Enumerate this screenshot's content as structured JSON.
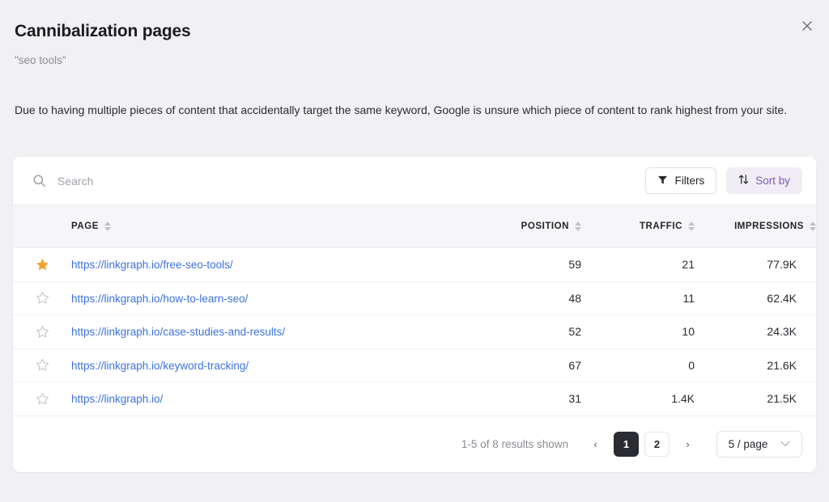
{
  "modal": {
    "title": "Cannibalization pages",
    "subtitle": "\"seo tools\"",
    "description": "Due to having multiple pieces of content that accidentally target the same keyword, Google is unsure which piece of content to rank highest from your site.",
    "close_label": "×"
  },
  "toolbar": {
    "search_placeholder": "Search",
    "search_value": "",
    "filters_label": "Filters",
    "sort_label": "Sort by"
  },
  "table": {
    "columns": [
      {
        "key": "star",
        "label": ""
      },
      {
        "key": "page",
        "label": "PAGE"
      },
      {
        "key": "position",
        "label": "POSITION"
      },
      {
        "key": "traffic",
        "label": "TRAFFIC"
      },
      {
        "key": "impressions",
        "label": "IMPRESSIONS"
      }
    ],
    "rows": [
      {
        "starred": true,
        "page": "https://linkgraph.io/free-seo-tools/",
        "position": "59",
        "traffic": "21",
        "impressions": "77.9K"
      },
      {
        "starred": false,
        "page": "https://linkgraph.io/how-to-learn-seo/",
        "position": "48",
        "traffic": "11",
        "impressions": "62.4K"
      },
      {
        "starred": false,
        "page": "https://linkgraph.io/case-studies-and-results/",
        "position": "52",
        "traffic": "10",
        "impressions": "24.3K"
      },
      {
        "starred": false,
        "page": "https://linkgraph.io/keyword-tracking/",
        "position": "67",
        "traffic": "0",
        "impressions": "21.6K"
      },
      {
        "starred": false,
        "page": "https://linkgraph.io/",
        "position": "31",
        "traffic": "1.4K",
        "impressions": "21.5K"
      }
    ]
  },
  "pagination": {
    "results_text": "1-5 of 8 results shown",
    "prev_label": "‹",
    "next_label": "›",
    "pages": [
      "1",
      "2"
    ],
    "current_page": "1",
    "per_page_label": "5 / page"
  },
  "colors": {
    "page_background": "#f1f1f4",
    "card_background": "#ffffff",
    "link": "#3b72dd",
    "star_active": "#f0a531",
    "star_inactive": "#c7c7cf",
    "sort_accent": "#7a5bb5",
    "sort_background": "#f1edf7",
    "active_page": "#2b2c31"
  }
}
